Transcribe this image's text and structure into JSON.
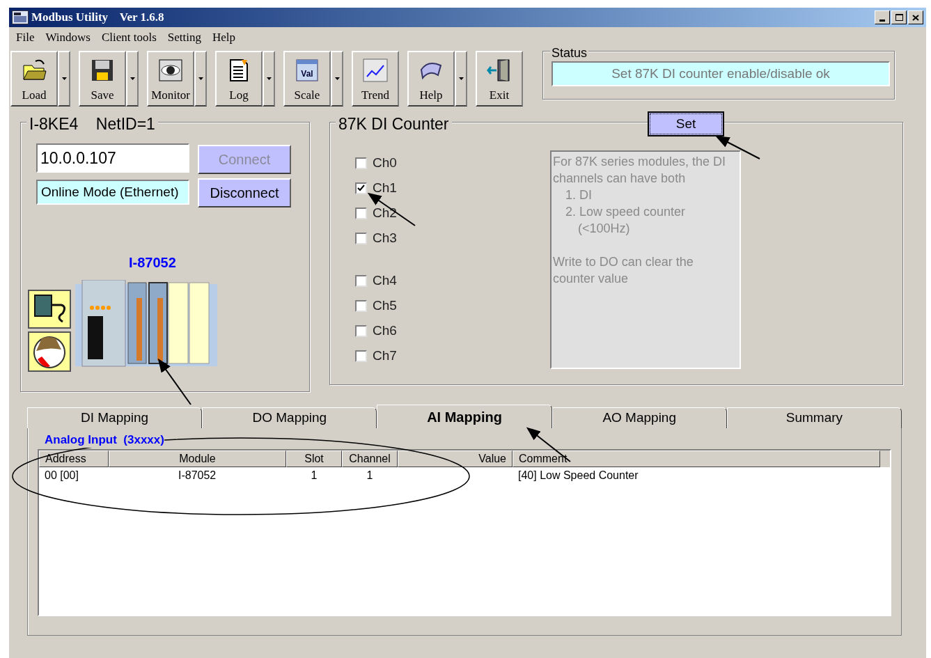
{
  "window": {
    "title": "Modbus Utility    Ver 1.6.8"
  },
  "menu": [
    "File",
    "Windows",
    "Client tools",
    "Setting",
    "Help"
  ],
  "toolbar": [
    {
      "kind": "load",
      "label": "Load",
      "dropdown": true
    },
    {
      "kind": "save",
      "label": "Save",
      "dropdown": true
    },
    {
      "kind": "monitor",
      "label": "Monitor",
      "dropdown": true
    },
    {
      "kind": "log",
      "label": "Log",
      "dropdown": true
    },
    {
      "kind": "scale",
      "label": "Scale",
      "dropdown": true,
      "icon_text": "Val"
    },
    {
      "kind": "trend",
      "label": "Trend",
      "dropdown": false
    },
    {
      "kind": "help",
      "label": "Help",
      "dropdown": true
    },
    {
      "kind": "exit",
      "label": "Exit",
      "dropdown": false
    }
  ],
  "status": {
    "label": "Status",
    "text": "Set 87K DI counter enable/disable ok"
  },
  "connection": {
    "title": "I-8KE4    NetID=1",
    "ip_value": "10.0.0.107",
    "mode_text": "Online Mode (Ethernet)",
    "buttons": [
      {
        "label": "Connect",
        "disabled": true
      },
      {
        "label": "Disconnect",
        "disabled": false
      }
    ],
    "module_label": "I-87052"
  },
  "di_counter": {
    "title": "87K DI Counter",
    "set_button": "Set",
    "channels": [
      {
        "label": "Ch0",
        "checked": false
      },
      {
        "label": "Ch1",
        "checked": true
      },
      {
        "label": "Ch2",
        "checked": false
      },
      {
        "label": "Ch3",
        "checked": false
      },
      {
        "label": "Ch4",
        "checked": false
      },
      {
        "label": "Ch5",
        "checked": false
      },
      {
        "label": "Ch6",
        "checked": false
      },
      {
        "label": "Ch7",
        "checked": false
      }
    ],
    "note": {
      "intro": "For 87K series modules, the DI channels can have both",
      "items": [
        "1. DI",
        "2. Low speed counter (<100Hz)"
      ],
      "outro": "Write to DO can clear the counter value"
    }
  },
  "tabs": [
    {
      "label": "DI Mapping",
      "selected": false
    },
    {
      "label": "DO Mapping",
      "selected": false
    },
    {
      "label": "AI Mapping",
      "selected": true
    },
    {
      "label": "AO Mapping",
      "selected": false
    },
    {
      "label": "Summary",
      "selected": false
    }
  ],
  "mapping": {
    "section_title": "Analog Input  (3xxxx)",
    "table": {
      "columns": [
        "Address",
        "Module",
        "Slot",
        "Channel",
        "Value",
        "Comment"
      ],
      "rows": [
        [
          "00 [00]",
          "I-87052",
          "1",
          "1",
          "",
          "[40] Low Speed Counter"
        ]
      ]
    }
  }
}
